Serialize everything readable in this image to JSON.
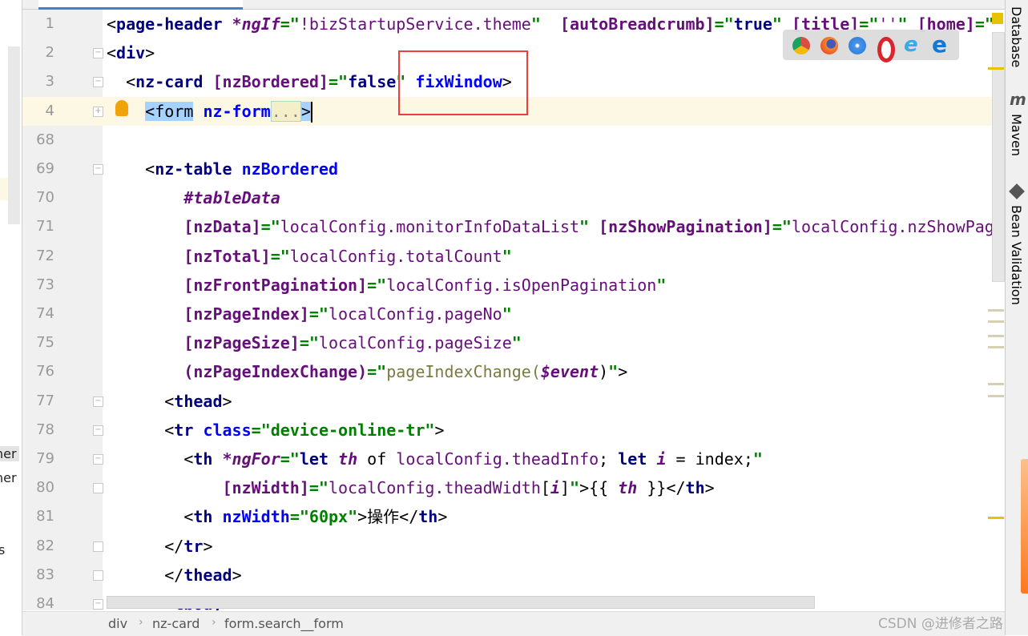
{
  "left_panel": {
    "fragments": [
      "ner",
      "ner",
      "s"
    ]
  },
  "editor": {
    "lines": [
      {
        "n": "1",
        "fold": "",
        "tokens": [
          [
            "br",
            "<"
          ],
          [
            "tag",
            "page-header"
          ],
          [
            "plain",
            " "
          ],
          [
            "ital",
            "*ngIf"
          ],
          [
            "eq",
            "=\""
          ],
          [
            "expr",
            "!bizStartupService.theme"
          ],
          [
            "eq",
            "\""
          ],
          [
            "plain",
            "  "
          ],
          [
            "bind",
            "[autoBreadcrumb]"
          ],
          [
            "eq",
            "=\""
          ],
          [
            "kw",
            "true"
          ],
          [
            "eq",
            "\""
          ],
          [
            "plain",
            " "
          ],
          [
            "bind",
            "[title]"
          ],
          [
            "eq",
            "=\""
          ],
          [
            "expr",
            "''"
          ],
          [
            "eq",
            "\""
          ],
          [
            "plain",
            " "
          ],
          [
            "bind",
            "[home]"
          ],
          [
            "eq",
            "=\""
          ]
        ]
      },
      {
        "n": "2",
        "fold": "-",
        "tokens": [
          [
            "br",
            "<"
          ],
          [
            "tag",
            "div"
          ],
          [
            "br",
            ">"
          ]
        ]
      },
      {
        "n": "3",
        "fold": "-",
        "tokens": [
          [
            "plain",
            "  "
          ],
          [
            "br",
            "<"
          ],
          [
            "tag",
            "nz-card"
          ],
          [
            "plain",
            " "
          ],
          [
            "bind",
            "[nzBordered]"
          ],
          [
            "eq",
            "=\""
          ],
          [
            "kw",
            "false"
          ],
          [
            "eq",
            "\""
          ],
          [
            "plain",
            " "
          ],
          [
            "attr",
            "fixWindow"
          ],
          [
            "br",
            ">"
          ]
        ]
      },
      {
        "n": "4",
        "fold": "+",
        "caret": true,
        "tokens": [
          [
            "plain",
            "    "
          ],
          [
            "sel",
            "<form"
          ],
          [
            "plain",
            " "
          ],
          [
            "attr",
            "nz-form"
          ],
          [
            "fold",
            "..."
          ],
          [
            "sel",
            ">"
          ]
        ]
      },
      {
        "n": "68",
        "fold": "",
        "tokens": []
      },
      {
        "n": "69",
        "fold": "-",
        "tokens": [
          [
            "plain",
            "    "
          ],
          [
            "br",
            "<"
          ],
          [
            "tag",
            "nz-table"
          ],
          [
            "plain",
            " "
          ],
          [
            "attr",
            "nzBordered"
          ]
        ]
      },
      {
        "n": "70",
        "fold": "",
        "tokens": [
          [
            "plain",
            "        "
          ],
          [
            "ital",
            "#tableData"
          ]
        ]
      },
      {
        "n": "71",
        "fold": "",
        "tokens": [
          [
            "plain",
            "        "
          ],
          [
            "bind",
            "[nzData]"
          ],
          [
            "eq",
            "=\""
          ],
          [
            "expr",
            "localConfig.monitorInfoDataList"
          ],
          [
            "eq",
            "\""
          ],
          [
            "plain",
            " "
          ],
          [
            "bind",
            "[nzShowPagination]"
          ],
          [
            "eq",
            "=\""
          ],
          [
            "expr",
            "localConfig.nzShowPagination"
          ]
        ]
      },
      {
        "n": "72",
        "fold": "",
        "tokens": [
          [
            "plain",
            "        "
          ],
          [
            "bind",
            "[nzTotal]"
          ],
          [
            "eq",
            "=\""
          ],
          [
            "expr",
            "localConfig.totalCount"
          ],
          [
            "eq",
            "\""
          ]
        ]
      },
      {
        "n": "73",
        "fold": "",
        "tokens": [
          [
            "plain",
            "        "
          ],
          [
            "bind",
            "[nzFrontPagination]"
          ],
          [
            "eq",
            "=\""
          ],
          [
            "expr",
            "localConfig.isOpenPagination"
          ],
          [
            "eq",
            "\""
          ]
        ]
      },
      {
        "n": "74",
        "fold": "",
        "tokens": [
          [
            "plain",
            "        "
          ],
          [
            "bind",
            "[nzPageIndex]"
          ],
          [
            "eq",
            "=\""
          ],
          [
            "expr",
            "localConfig.pageNo"
          ],
          [
            "eq",
            "\""
          ]
        ]
      },
      {
        "n": "75",
        "fold": "",
        "tokens": [
          [
            "plain",
            "        "
          ],
          [
            "bind",
            "[nzPageSize]"
          ],
          [
            "eq",
            "=\""
          ],
          [
            "expr",
            "localConfig.pageSize"
          ],
          [
            "eq",
            "\""
          ]
        ]
      },
      {
        "n": "76",
        "fold": "",
        "tokens": [
          [
            "plain",
            "        "
          ],
          [
            "bind",
            "(nzPageIndexChange)"
          ],
          [
            "eq",
            "=\""
          ],
          [
            "fn",
            "pageIndexChange("
          ],
          [
            "ital",
            "$event"
          ],
          [
            "plain",
            ")"
          ],
          [
            "eq",
            "\""
          ],
          [
            "br",
            ">"
          ]
        ]
      },
      {
        "n": "77",
        "fold": "-",
        "tokens": [
          [
            "plain",
            "      "
          ],
          [
            "br",
            "<"
          ],
          [
            "tag",
            "thead"
          ],
          [
            "br",
            ">"
          ]
        ]
      },
      {
        "n": "78",
        "fold": "-",
        "tokens": [
          [
            "plain",
            "      "
          ],
          [
            "br",
            "<"
          ],
          [
            "tag",
            "tr"
          ],
          [
            "plain",
            " "
          ],
          [
            "attr",
            "class"
          ],
          [
            "eq",
            "=\""
          ],
          [
            "str",
            "device-online-tr"
          ],
          [
            "eq",
            "\""
          ],
          [
            "br",
            ">"
          ]
        ]
      },
      {
        "n": "79",
        "fold": "-",
        "tokens": [
          [
            "plain",
            "        "
          ],
          [
            "br",
            "<"
          ],
          [
            "tag",
            "th"
          ],
          [
            "plain",
            " "
          ],
          [
            "ital",
            "*ngFor"
          ],
          [
            "eq",
            "=\""
          ],
          [
            "kw",
            "let"
          ],
          [
            "plain",
            " "
          ],
          [
            "ital",
            "th"
          ],
          [
            "plain",
            " of "
          ],
          [
            "expr",
            "localConfig.theadInfo"
          ],
          [
            "plain",
            "; "
          ],
          [
            "kw",
            "let"
          ],
          [
            "plain",
            " "
          ],
          [
            "ital",
            "i"
          ],
          [
            "plain",
            " = index;"
          ],
          [
            "eq",
            "\""
          ]
        ]
      },
      {
        "n": "80",
        "fold": "^",
        "tokens": [
          [
            "plain",
            "            "
          ],
          [
            "bind",
            "[nzWidth]"
          ],
          [
            "eq",
            "=\""
          ],
          [
            "expr",
            "localConfig.theadWidth"
          ],
          [
            "plain",
            "["
          ],
          [
            "ital",
            "i"
          ],
          [
            "plain",
            "]"
          ],
          [
            "eq",
            "\""
          ],
          [
            "br",
            ">"
          ],
          [
            "plain",
            "{{ "
          ],
          [
            "ital",
            "th"
          ],
          [
            "plain",
            " }}</"
          ],
          [
            "tag",
            "th"
          ],
          [
            "br",
            ">"
          ]
        ]
      },
      {
        "n": "81",
        "fold": "",
        "tokens": [
          [
            "plain",
            "        "
          ],
          [
            "br",
            "<"
          ],
          [
            "tag",
            "th"
          ],
          [
            "plain",
            " "
          ],
          [
            "attr",
            "nzWidth"
          ],
          [
            "eq",
            "=\""
          ],
          [
            "str",
            "60px"
          ],
          [
            "eq",
            "\""
          ],
          [
            "br",
            ">"
          ],
          [
            "plain",
            "操作"
          ],
          [
            "br",
            "</"
          ],
          [
            "tag",
            "th"
          ],
          [
            "br",
            ">"
          ]
        ]
      },
      {
        "n": "82",
        "fold": "^",
        "tokens": [
          [
            "plain",
            "      "
          ],
          [
            "br",
            "</"
          ],
          [
            "tag",
            "tr"
          ],
          [
            "br",
            ">"
          ]
        ]
      },
      {
        "n": "83",
        "fold": "^",
        "tokens": [
          [
            "plain",
            "      "
          ],
          [
            "br",
            "</"
          ],
          [
            "tag",
            "thead"
          ],
          [
            "br",
            ">"
          ]
        ]
      },
      {
        "n": "84",
        "fold": "-",
        "tokens": [
          [
            "plain",
            "      "
          ],
          [
            "br",
            "<"
          ],
          [
            "tag",
            "tbody"
          ],
          [
            "br",
            ">"
          ]
        ]
      }
    ]
  },
  "browser_icons": [
    "chrome-icon",
    "firefox-icon",
    "safari-icon",
    "opera-icon",
    "ie-icon",
    "edge-icon"
  ],
  "tool_windows": [
    "Database",
    "Maven",
    "Bean Validation"
  ],
  "breadcrumb": [
    "div",
    "nz-card",
    "form.search__form"
  ],
  "watermark": "CSDN @进修者之路"
}
